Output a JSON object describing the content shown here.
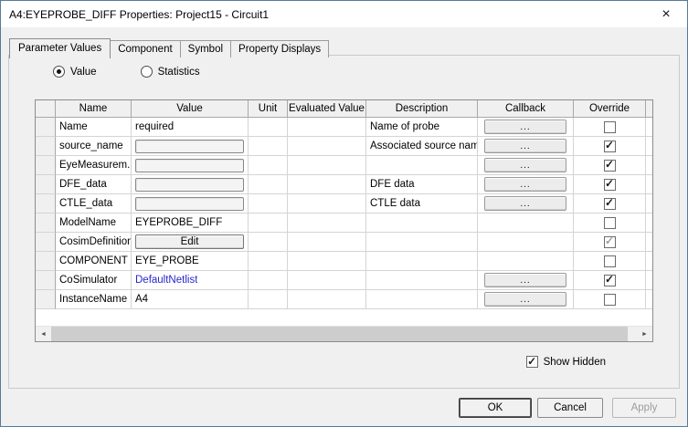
{
  "window": {
    "title": "A4:EYEPROBE_DIFF Properties: Project15 - Circuit1",
    "close_icon": "close"
  },
  "tabs": [
    {
      "label": "Parameter Values",
      "active": true
    },
    {
      "label": "Component",
      "active": false
    },
    {
      "label": "Symbol",
      "active": false
    },
    {
      "label": "Property Displays",
      "active": false
    }
  ],
  "radios": [
    {
      "label": "Value",
      "checked": true
    },
    {
      "label": "Statistics",
      "checked": false
    }
  ],
  "table": {
    "headers": [
      "Name",
      "Value",
      "Unit",
      "Evaluated Value",
      "Description",
      "Callback",
      "Override"
    ],
    "callback_label": "...",
    "rows": [
      {
        "name": "Name",
        "value": "required",
        "value_type": "text",
        "description": "Name of probe",
        "callback": true,
        "override": "unchecked"
      },
      {
        "name": "source_name",
        "value": "",
        "value_type": "input",
        "description": "Associated source name",
        "callback": true,
        "override": "checked"
      },
      {
        "name": "EyeMeasurem...",
        "value": "",
        "value_type": "input",
        "description": "",
        "callback": true,
        "override": "checked"
      },
      {
        "name": "DFE_data",
        "value": "",
        "value_type": "input",
        "description": "DFE data",
        "callback": true,
        "override": "checked"
      },
      {
        "name": "CTLE_data",
        "value": "",
        "value_type": "input",
        "description": "CTLE data",
        "callback": true,
        "override": "checked"
      },
      {
        "name": "ModelName",
        "value": "EYEPROBE_DIFF",
        "value_type": "text",
        "description": "",
        "callback": false,
        "override": "unchecked"
      },
      {
        "name": "CosimDefinition",
        "value": "Edit",
        "value_type": "button",
        "description": "",
        "callback": false,
        "override": "checked_disabled"
      },
      {
        "name": "COMPONENT",
        "value": "EYE_PROBE",
        "value_type": "text",
        "description": "",
        "callback": false,
        "override": "unchecked"
      },
      {
        "name": "CoSimulator",
        "value": "DefaultNetlist",
        "value_type": "link",
        "description": "",
        "callback": true,
        "override": "checked"
      },
      {
        "name": "InstanceName",
        "value": "A4",
        "value_type": "text",
        "description": "",
        "callback": true,
        "override": "unchecked"
      }
    ]
  },
  "show_hidden": {
    "label": "Show Hidden",
    "checked": true
  },
  "buttons": {
    "ok": "OK",
    "cancel": "Cancel",
    "apply": "Apply"
  },
  "colors": {
    "link": "#2626cc",
    "check": "#1b1b1b",
    "check_disabled": "#9e9e9e",
    "titlebar_bg": "#ffffff",
    "dialog_bg": "#f0f0f0"
  }
}
